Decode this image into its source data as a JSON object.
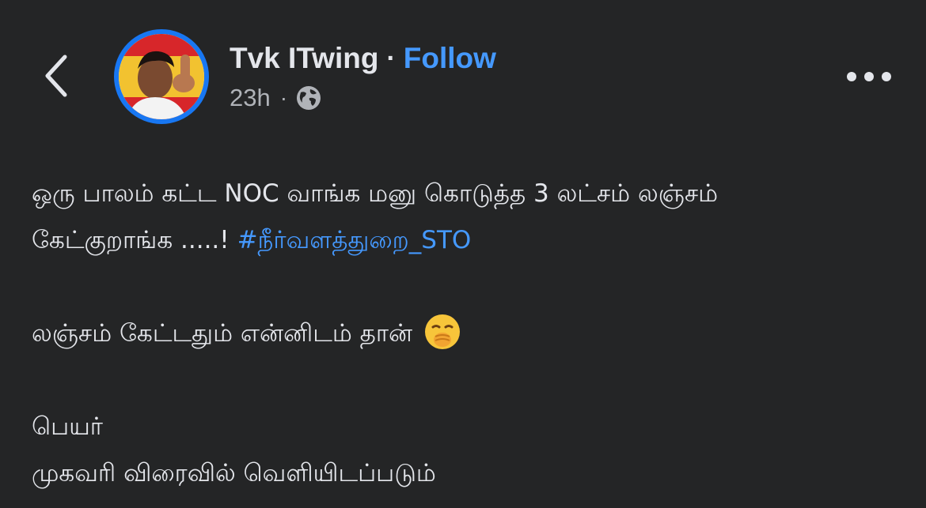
{
  "header": {
    "author_name": "Tvk ITwing",
    "separator": "·",
    "follow_label": "Follow",
    "timestamp": "23h",
    "meta_separator": "·",
    "privacy_icon": "globe-icon",
    "back_icon": "chevron-left-icon",
    "more_icon": "more-horizontal-icon",
    "avatar_icon": "profile-avatar"
  },
  "post": {
    "line1": "ஒரு பாலம் கட்ட NOC வாங்க மனு கொடுத்த 3 லட்சம் லஞ்சம்",
    "line2_text": "கேட்குறாங்க .....! ",
    "hashtag": "#நீர்வளத்துறை_STO",
    "line3_text": "லஞ்சம் கேட்டதும் என்னிடம் தான் ",
    "emoji_icon": "face-with-hand-over-mouth-emoji",
    "line4": "பெயர்",
    "line5": "முகவரி விரைவில் வெளியிடப்படும்"
  },
  "colors": {
    "background": "#242526",
    "text": "#e4e6eb",
    "secondary_text": "#b0b3b8",
    "link": "#4599ff",
    "avatar_ring": "#1877f2"
  }
}
